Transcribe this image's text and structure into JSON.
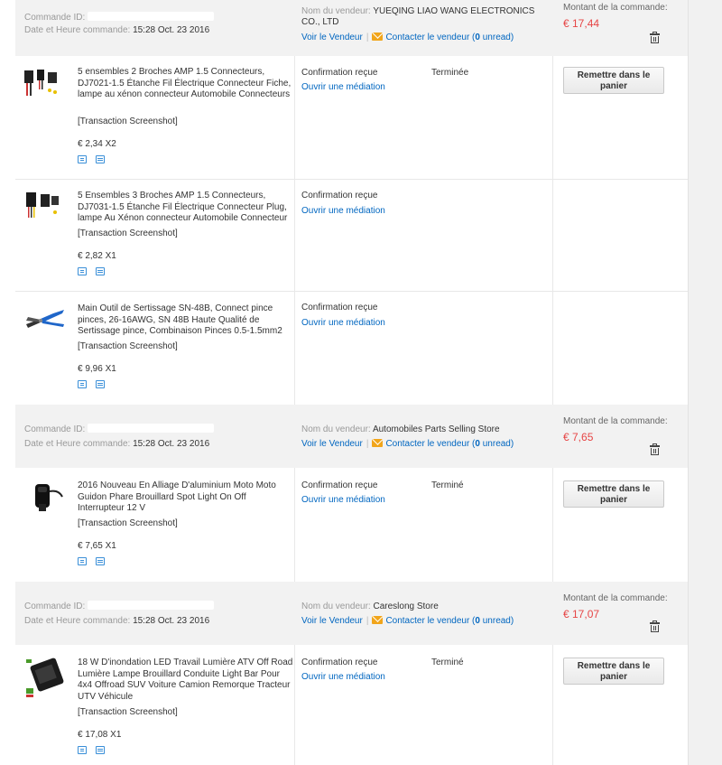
{
  "labels": {
    "order_id": "Commande ID:",
    "order_date": "Date et Heure commande:",
    "seller": "Nom du vendeur:",
    "view_seller": "Voir le Vendeur",
    "contact_seller": "Contacter le vendeur",
    "unread_count": "0",
    "unread_word": "unread",
    "amount": "Montant de la commande:",
    "screenshot": "[Transaction Screenshot]",
    "status": "Confirmation reçue",
    "mediation": "Ouvrir une médiation",
    "add_to_cart": "Remettre dans le panier",
    "completed_f": "Terminée",
    "completed_m": "Terminé"
  },
  "orders": [
    {
      "date": "15:28 Oct. 23 2016",
      "seller": "YUEQING LIAO WANG ELECTRONICS CO., LTD",
      "amount": "€ 17,44",
      "items": [
        {
          "title": "5 ensembles 2 Broches AMP 1.5 Connecteurs, DJ7021-1.5 Étanche Fil Électrique Connecteur Fiche, lampe au xénon connecteur Automobile Connecteurs",
          "price": "€ 2,34 X2",
          "completion": "Terminée"
        },
        {
          "title": "5 Ensembles 3 Broches AMP 1.5 Connecteurs, DJ7031-1.5 Étanche Fil Électrique Connecteur Plug, lampe Au Xénon connecteur Automobile Connecteur",
          "price": "€ 2,82 X1",
          "completion": ""
        },
        {
          "title": "Main Outil de Sertissage SN-48B, Connect pince pinces, 26-16AWG, SN 48B Haute Qualité de Sertissage pince, Combinaison Pinces 0.5-1.5mm2",
          "price": "€ 9,96 X1",
          "completion": ""
        }
      ]
    },
    {
      "date": "15:28 Oct. 23 2016",
      "seller": "Automobiles Parts Selling Store",
      "amount": "€ 7,65",
      "items": [
        {
          "title": "2016 Nouveau En Alliage D'aluminium Moto Moto Guidon Phare Brouillard Spot Light On Off Interrupteur 12 V",
          "price": "€ 7,65 X1",
          "completion": "Terminé"
        }
      ]
    },
    {
      "date": "15:28 Oct. 23 2016",
      "seller": "Careslong Store",
      "amount": "€ 17,07",
      "items": [
        {
          "title": "18 W D'inondation LED Travail Lumière ATV Off Road Lumière Lampe Brouillard Conduite Light Bar Pour 4x4 Offroad SUV Voiture Camion Remorque Tracteur UTV Véhicule",
          "price": "€ 17,08 X1",
          "completion": "Terminé"
        }
      ]
    }
  ]
}
